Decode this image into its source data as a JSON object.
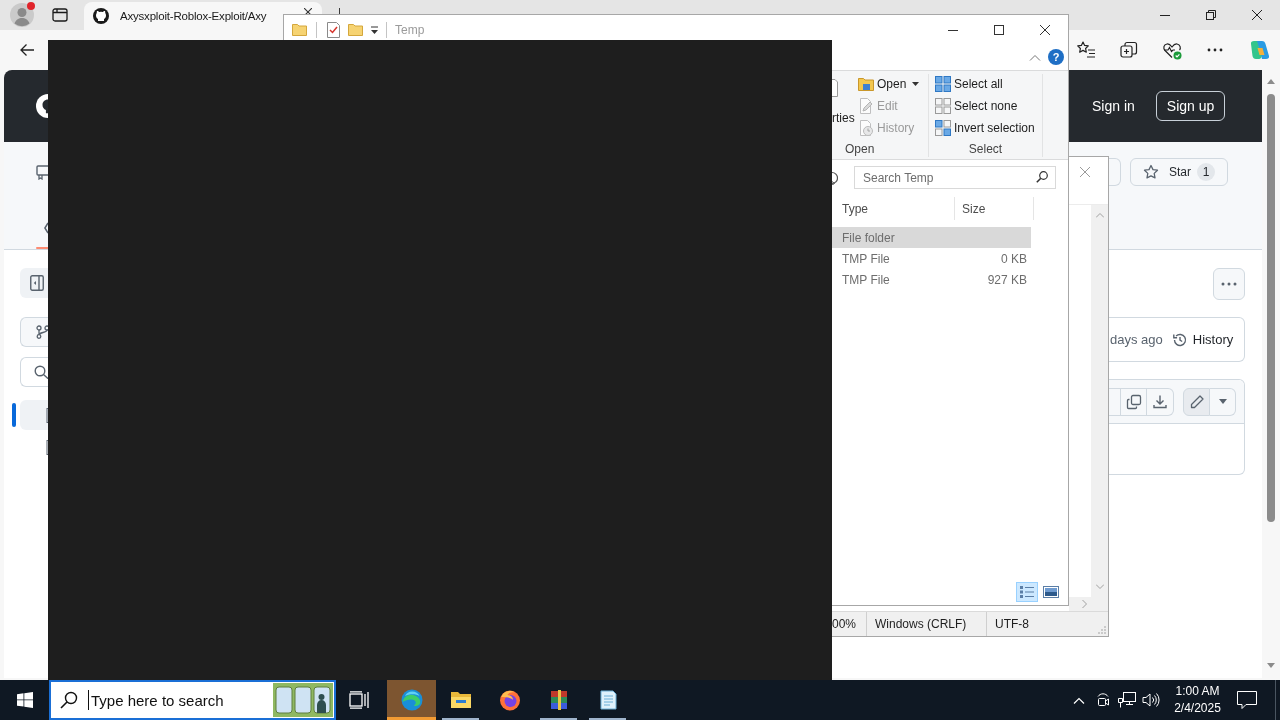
{
  "browser": {
    "tab": {
      "title": "Axysxploit-Roblox-Exploit/Axy",
      "selected": true
    },
    "header": {
      "sign_in": "Sign in",
      "sign_up": "Sign up"
    },
    "repo_actions": {
      "star_label": "Star",
      "star_count": "1"
    },
    "file_header": {
      "age": "days ago",
      "history": "History"
    }
  },
  "explorer": {
    "title": "Temp",
    "help": "?",
    "ribbon": {
      "groups": [
        {
          "label": "Open",
          "cut_button_label": "rties",
          "items": [
            {
              "label": "Open",
              "kind": "open",
              "has_menu": true,
              "disabled": false
            },
            {
              "label": "Edit",
              "kind": "edit",
              "has_menu": false,
              "disabled": true
            },
            {
              "label": "History",
              "kind": "history",
              "has_menu": false,
              "disabled": true
            }
          ]
        },
        {
          "label": "Select",
          "items": [
            {
              "label": "Select all",
              "kind": "select_all",
              "has_menu": false,
              "disabled": false
            },
            {
              "label": "Select none",
              "kind": "select_none",
              "has_menu": false,
              "disabled": false
            },
            {
              "label": "Invert selection",
              "kind": "invert",
              "has_menu": false,
              "disabled": false
            }
          ]
        }
      ]
    },
    "search": {
      "placeholder": "Search Temp"
    },
    "columns": [
      "Type",
      "Size"
    ],
    "rows": [
      {
        "type": "File folder",
        "selected": true
      },
      {
        "type": "TMP File",
        "size": "0 KB",
        "selected": false
      },
      {
        "type": "TMP File",
        "size": "927 KB",
        "selected": false
      }
    ],
    "views": [
      {
        "kind": "details",
        "selected": true
      },
      {
        "kind": "large_icons",
        "selected": false
      }
    ]
  },
  "notepad": {
    "status_bar": {
      "zoom": "00%",
      "line_ending": "Windows (CRLF)",
      "encoding": "UTF-8"
    }
  },
  "taskbar": {
    "search": {
      "placeholder": "Type here to search"
    },
    "apps": [
      {
        "kind": "browser",
        "running": true,
        "flashing": true
      },
      {
        "kind": "folder",
        "running": true,
        "flashing": false
      },
      {
        "kind": "globe",
        "running": false,
        "flashing": false
      },
      {
        "kind": "archive",
        "running": true,
        "flashing": false
      },
      {
        "kind": "notepad",
        "running": true,
        "flashing": false
      }
    ],
    "clock": {
      "time": "1:00 AM",
      "date": "2/4/2025"
    }
  }
}
